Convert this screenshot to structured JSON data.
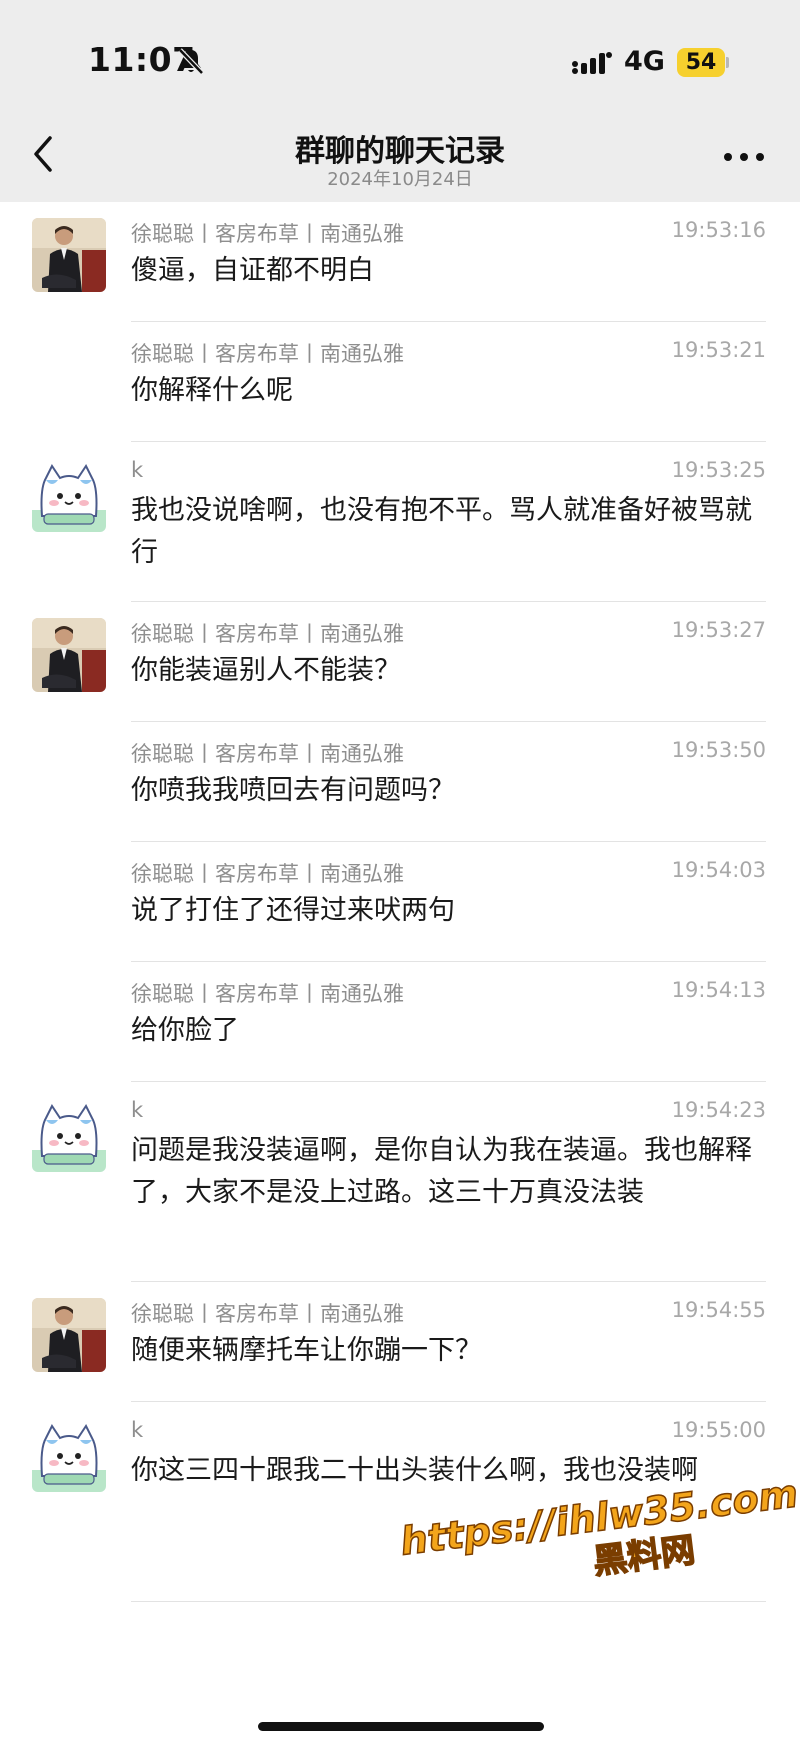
{
  "status_bar": {
    "time": "11:07",
    "network": "4G",
    "battery": "54",
    "icons": [
      "bell-slash-icon",
      "signal-icon"
    ]
  },
  "nav": {
    "title": "群聊的聊天记录",
    "subtitle": "2024年10月24日",
    "icons": [
      "back-chevron-icon",
      "more-dots-icon"
    ]
  },
  "messages": [
    {
      "sender": "徐聪聪丨客房布草丨南通弘雅",
      "time": "19:53:16",
      "text": "傻逼，自证都不明白",
      "avatar": "man-suit-avatar"
    },
    {
      "sender": "徐聪聪丨客房布草丨南通弘雅",
      "time": "19:53:21",
      "text": "你解释什么呢",
      "avatar": ""
    },
    {
      "sender": "k",
      "time": "19:53:25",
      "text": "我也没说啥啊，也没有抱不平。骂人就准备好被骂就行",
      "avatar": "cartoon-cat-avatar"
    },
    {
      "sender": "徐聪聪丨客房布草丨南通弘雅",
      "time": "19:53:27",
      "text": "你能装逼别人不能装？",
      "avatar": "man-suit-avatar"
    },
    {
      "sender": "徐聪聪丨客房布草丨南通弘雅",
      "time": "19:53:50",
      "text": "你喷我我喷回去有问题吗？",
      "avatar": ""
    },
    {
      "sender": "徐聪聪丨客房布草丨南通弘雅",
      "time": "19:54:03",
      "text": "说了打住了还得过来吠两句",
      "avatar": ""
    },
    {
      "sender": "徐聪聪丨客房布草丨南通弘雅",
      "time": "19:54:13",
      "text": "给你脸了",
      "avatar": ""
    },
    {
      "sender": "k",
      "time": "19:54:23",
      "text": "问题是我没装逼啊，是你自认为我在装逼。我也解释了，大家不是没上过路。这三十万真没法装",
      "avatar": "cartoon-cat-avatar"
    },
    {
      "sender": "徐聪聪丨客房布草丨南通弘雅",
      "time": "19:54:55",
      "text": "随便来辆摩托车让你蹦一下？",
      "avatar": "man-suit-avatar"
    },
    {
      "sender": "k",
      "time": "19:55:00",
      "text": "你这三四十跟我二十出头装什么啊，我也没装啊",
      "avatar": "cartoon-cat-avatar"
    }
  ],
  "watermark": {
    "url": "https://ihlw35.com",
    "name": "黑料网"
  },
  "colors": {
    "header_bg": "#ededed",
    "battery": "#f6d02e",
    "meta_text": "#8e8e8e",
    "watermark": "#f3a51b"
  }
}
